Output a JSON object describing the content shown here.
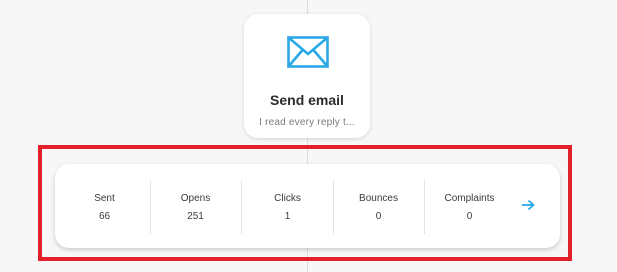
{
  "node": {
    "icon": "envelope-icon",
    "title": "Send email",
    "subtitle": "I read every reply t..."
  },
  "stats": [
    {
      "label": "Sent",
      "value": "66"
    },
    {
      "label": "Opens",
      "value": "251"
    },
    {
      "label": "Clicks",
      "value": "1"
    },
    {
      "label": "Bounces",
      "value": "0"
    },
    {
      "label": "Complaints",
      "value": "0"
    }
  ],
  "arrow": {
    "icon": "arrow-right-icon"
  },
  "colors": {
    "accent": "#29a8e8",
    "highlight": "#e2202c"
  }
}
